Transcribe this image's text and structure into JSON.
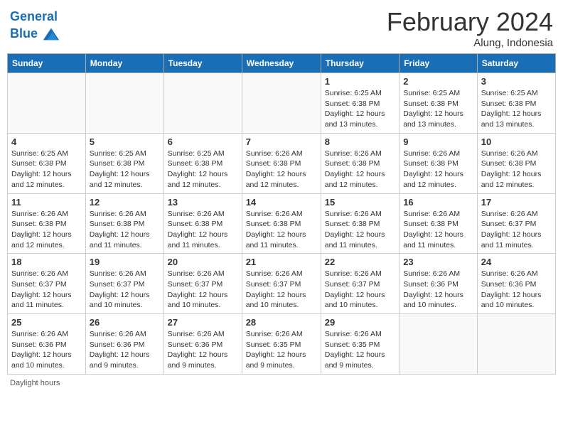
{
  "header": {
    "logo_line1": "General",
    "logo_line2": "Blue",
    "month_title": "February 2024",
    "subtitle": "Alung, Indonesia"
  },
  "days_of_week": [
    "Sunday",
    "Monday",
    "Tuesday",
    "Wednesday",
    "Thursday",
    "Friday",
    "Saturday"
  ],
  "weeks": [
    [
      {
        "day": "",
        "info": ""
      },
      {
        "day": "",
        "info": ""
      },
      {
        "day": "",
        "info": ""
      },
      {
        "day": "",
        "info": ""
      },
      {
        "day": "1",
        "info": "Sunrise: 6:25 AM\nSunset: 6:38 PM\nDaylight: 12 hours\nand 13 minutes."
      },
      {
        "day": "2",
        "info": "Sunrise: 6:25 AM\nSunset: 6:38 PM\nDaylight: 12 hours\nand 13 minutes."
      },
      {
        "day": "3",
        "info": "Sunrise: 6:25 AM\nSunset: 6:38 PM\nDaylight: 12 hours\nand 13 minutes."
      }
    ],
    [
      {
        "day": "4",
        "info": "Sunrise: 6:25 AM\nSunset: 6:38 PM\nDaylight: 12 hours\nand 12 minutes."
      },
      {
        "day": "5",
        "info": "Sunrise: 6:25 AM\nSunset: 6:38 PM\nDaylight: 12 hours\nand 12 minutes."
      },
      {
        "day": "6",
        "info": "Sunrise: 6:25 AM\nSunset: 6:38 PM\nDaylight: 12 hours\nand 12 minutes."
      },
      {
        "day": "7",
        "info": "Sunrise: 6:26 AM\nSunset: 6:38 PM\nDaylight: 12 hours\nand 12 minutes."
      },
      {
        "day": "8",
        "info": "Sunrise: 6:26 AM\nSunset: 6:38 PM\nDaylight: 12 hours\nand 12 minutes."
      },
      {
        "day": "9",
        "info": "Sunrise: 6:26 AM\nSunset: 6:38 PM\nDaylight: 12 hours\nand 12 minutes."
      },
      {
        "day": "10",
        "info": "Sunrise: 6:26 AM\nSunset: 6:38 PM\nDaylight: 12 hours\nand 12 minutes."
      }
    ],
    [
      {
        "day": "11",
        "info": "Sunrise: 6:26 AM\nSunset: 6:38 PM\nDaylight: 12 hours\nand 12 minutes."
      },
      {
        "day": "12",
        "info": "Sunrise: 6:26 AM\nSunset: 6:38 PM\nDaylight: 12 hours\nand 11 minutes."
      },
      {
        "day": "13",
        "info": "Sunrise: 6:26 AM\nSunset: 6:38 PM\nDaylight: 12 hours\nand 11 minutes."
      },
      {
        "day": "14",
        "info": "Sunrise: 6:26 AM\nSunset: 6:38 PM\nDaylight: 12 hours\nand 11 minutes."
      },
      {
        "day": "15",
        "info": "Sunrise: 6:26 AM\nSunset: 6:38 PM\nDaylight: 12 hours\nand 11 minutes."
      },
      {
        "day": "16",
        "info": "Sunrise: 6:26 AM\nSunset: 6:38 PM\nDaylight: 12 hours\nand 11 minutes."
      },
      {
        "day": "17",
        "info": "Sunrise: 6:26 AM\nSunset: 6:37 PM\nDaylight: 12 hours\nand 11 minutes."
      }
    ],
    [
      {
        "day": "18",
        "info": "Sunrise: 6:26 AM\nSunset: 6:37 PM\nDaylight: 12 hours\nand 11 minutes."
      },
      {
        "day": "19",
        "info": "Sunrise: 6:26 AM\nSunset: 6:37 PM\nDaylight: 12 hours\nand 10 minutes."
      },
      {
        "day": "20",
        "info": "Sunrise: 6:26 AM\nSunset: 6:37 PM\nDaylight: 12 hours\nand 10 minutes."
      },
      {
        "day": "21",
        "info": "Sunrise: 6:26 AM\nSunset: 6:37 PM\nDaylight: 12 hours\nand 10 minutes."
      },
      {
        "day": "22",
        "info": "Sunrise: 6:26 AM\nSunset: 6:37 PM\nDaylight: 12 hours\nand 10 minutes."
      },
      {
        "day": "23",
        "info": "Sunrise: 6:26 AM\nSunset: 6:36 PM\nDaylight: 12 hours\nand 10 minutes."
      },
      {
        "day": "24",
        "info": "Sunrise: 6:26 AM\nSunset: 6:36 PM\nDaylight: 12 hours\nand 10 minutes."
      }
    ],
    [
      {
        "day": "25",
        "info": "Sunrise: 6:26 AM\nSunset: 6:36 PM\nDaylight: 12 hours\nand 10 minutes."
      },
      {
        "day": "26",
        "info": "Sunrise: 6:26 AM\nSunset: 6:36 PM\nDaylight: 12 hours\nand 9 minutes."
      },
      {
        "day": "27",
        "info": "Sunrise: 6:26 AM\nSunset: 6:36 PM\nDaylight: 12 hours\nand 9 minutes."
      },
      {
        "day": "28",
        "info": "Sunrise: 6:26 AM\nSunset: 6:35 PM\nDaylight: 12 hours\nand 9 minutes."
      },
      {
        "day": "29",
        "info": "Sunrise: 6:26 AM\nSunset: 6:35 PM\nDaylight: 12 hours\nand 9 minutes."
      },
      {
        "day": "",
        "info": ""
      },
      {
        "day": "",
        "info": ""
      }
    ]
  ],
  "footer": {
    "text": "Daylight hours"
  }
}
